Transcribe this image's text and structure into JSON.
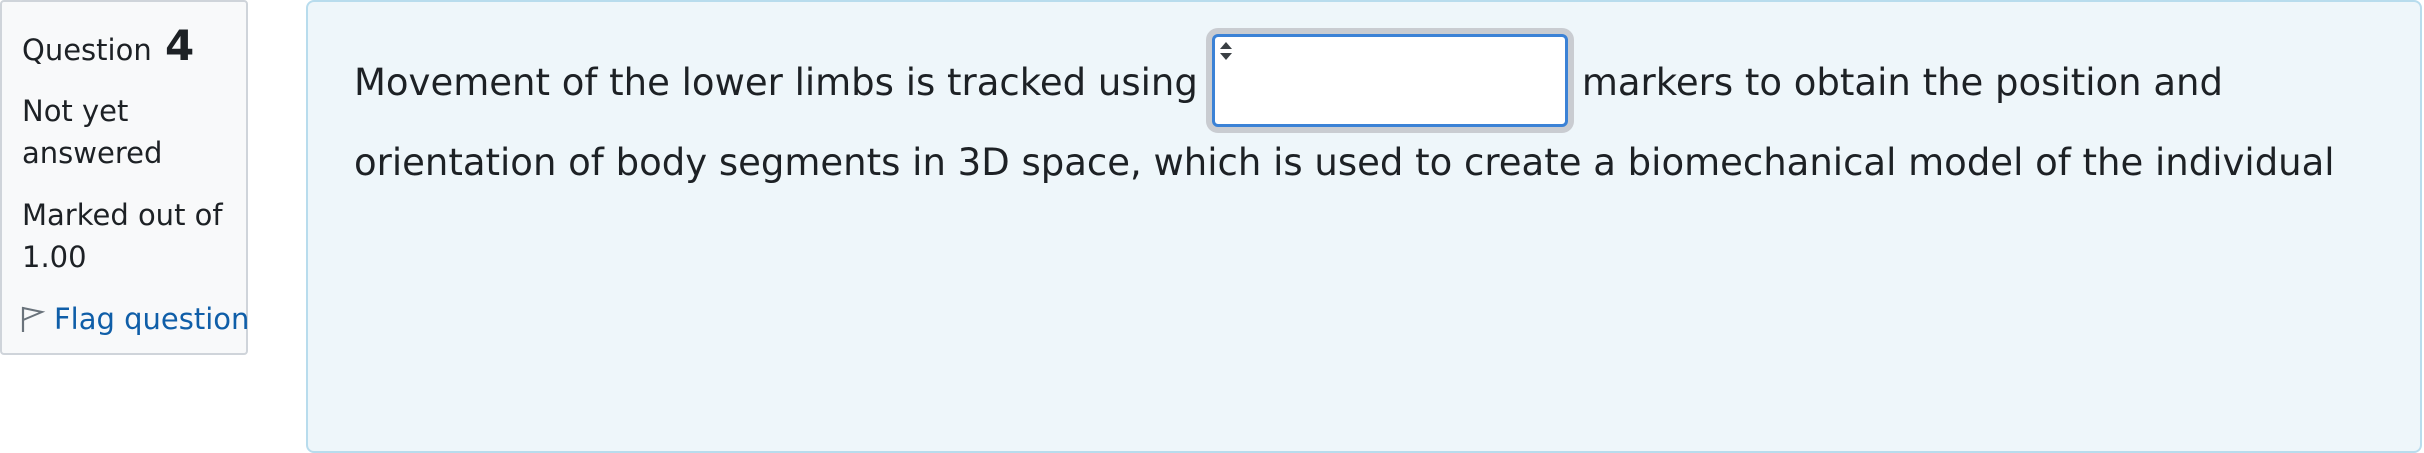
{
  "question_info": {
    "label": "Question",
    "number": "4",
    "state": "Not yet answered",
    "grade": "Marked out of 1.00",
    "flag_label": "Flag question"
  },
  "question": {
    "text_before": "Movement of the lower limbs is tracked using",
    "text_after_line1": "markers to obtain the position and",
    "text_line2": "orientation of body segments in 3D space, which is used to create a biomechanical model of the individual",
    "answer_select": {
      "selected_value": ""
    }
  },
  "colors": {
    "link": "#0f5ea8",
    "content_bg": "#eef6fa",
    "content_border": "#b8dced",
    "info_bg": "#f8f9fa",
    "select_focus": "#3b82d6"
  },
  "icons": {
    "flag": "flag-icon",
    "select": "spinner-arrows-icon"
  }
}
